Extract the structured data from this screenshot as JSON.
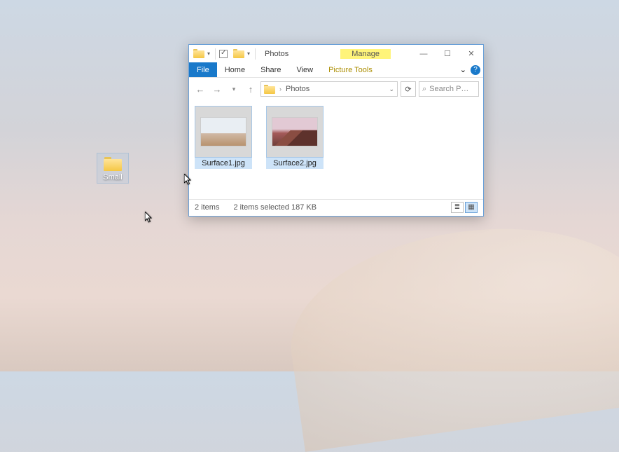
{
  "desktop": {
    "icons": [
      {
        "name": "Small"
      }
    ]
  },
  "window": {
    "title": "Photos",
    "contextual_tab": "Manage",
    "contextual_subtab": "Picture Tools",
    "controls": {
      "minimize": "—",
      "maximize": "☐",
      "close": "✕"
    },
    "ribbon": {
      "file": "File",
      "tabs": [
        "Home",
        "Share",
        "View"
      ],
      "collapse_chevron": "⌄",
      "help": "?"
    },
    "nav": {
      "back": "←",
      "forward": "→",
      "recent_dd": "▾",
      "up": "↑",
      "breadcrumb": [
        "Photos"
      ],
      "history_dd": "⌄",
      "refresh": "⟳",
      "search_placeholder": "Search P…",
      "search_icon": "⌕"
    },
    "files": [
      {
        "name": "Surface1.jpg",
        "selected": true,
        "thumb": "pic1"
      },
      {
        "name": "Surface2.jpg",
        "selected": true,
        "thumb": "pic2"
      }
    ],
    "status": {
      "count": "2 items",
      "selection": "2 items selected  187 KB",
      "view_details": "≣",
      "view_icons": "▦"
    }
  }
}
